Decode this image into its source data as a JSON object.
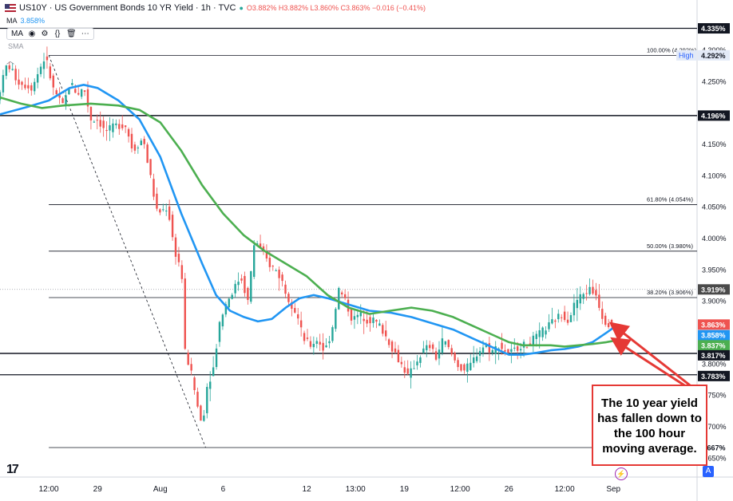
{
  "header": {
    "symbol": "US10Y · US Government Bonds 10 YR Yield · 1h · TVC",
    "ohlc": "O3.882% H3.882% L3.860% C3.863% −0.016 (−0.41%)"
  },
  "indicators": {
    "ma_label": "MA",
    "ma_value": "3.858%",
    "sma_label": "SMA",
    "toolbar_icons": [
      "eye-icon",
      "gear-icon",
      "code-icon",
      "trash-icon",
      "more-icon"
    ]
  },
  "callout": {
    "text_lines": [
      "The 10 year yield",
      "has fallen down to",
      "the 100 hour",
      "moving average."
    ]
  },
  "colors": {
    "ma100": "#2196f3",
    "ma200": "#4caf50",
    "up": "#26a69a",
    "down": "#ef5350",
    "arrow": "#e53935",
    "line": "#131722"
  },
  "chart_data": {
    "type": "candlestick",
    "ylim": [
      3.62,
      4.37
    ],
    "xlim": [
      0,
      100
    ],
    "x_ticks": [
      {
        "label": "12:00",
        "x": 7
      },
      {
        "label": "29",
        "x": 14
      },
      {
        "label": "Aug",
        "x": 23
      },
      {
        "label": "6",
        "x": 32
      },
      {
        "label": "12",
        "x": 44
      },
      {
        "label": "13:00",
        "x": 51
      },
      {
        "label": "19",
        "x": 58
      },
      {
        "label": "12:00",
        "x": 66
      },
      {
        "label": "26",
        "x": 73
      },
      {
        "label": "12:00",
        "x": 81
      },
      {
        "label": "Sep",
        "x": 88
      }
    ],
    "y_ticks": [
      {
        "label": "4.300%",
        "v": 4.3
      },
      {
        "label": "4.250%",
        "v": 4.25
      },
      {
        "label": "4.150%",
        "v": 4.15
      },
      {
        "label": "4.100%",
        "v": 4.1
      },
      {
        "label": "4.050%",
        "v": 4.05
      },
      {
        "label": "4.000%",
        "v": 4.0
      },
      {
        "label": "3.950%",
        "v": 3.95
      },
      {
        "label": "3.900%",
        "v": 3.9
      },
      {
        "label": "3.800%",
        "v": 3.8
      },
      {
        "label": "3.750%",
        "v": 3.75
      },
      {
        "label": "3.700%",
        "v": 3.7
      },
      {
        "label": "3.650%",
        "v": 3.65
      }
    ],
    "price_labels": [
      {
        "label": "4.335%",
        "v": 4.335,
        "bg": "#131722",
        "fg": "#ffffff"
      },
      {
        "label": "4.292%",
        "v": 4.292,
        "bg": "#e3eaf7",
        "fg": "#131722",
        "prefix": "High"
      },
      {
        "label": "4.196%",
        "v": 4.196,
        "bg": "#131722",
        "fg": "#ffffff"
      },
      {
        "label": "3.919%",
        "v": 3.919,
        "bg": "#4a4a4a",
        "fg": "#ffffff"
      },
      {
        "label": "3.863%",
        "v": 3.863,
        "bg": "#ef5350",
        "fg": "#ffffff"
      },
      {
        "label": "3.858%",
        "v": 3.846,
        "bg": "#2196f3",
        "fg": "#ffffff"
      },
      {
        "label": "3.837%",
        "v": 3.83,
        "bg": "#4caf50",
        "fg": "#ffffff"
      },
      {
        "label": "3.817%",
        "v": 3.814,
        "bg": "#131722",
        "fg": "#ffffff"
      },
      {
        "label": "3.783%",
        "v": 3.781,
        "bg": "#131722",
        "fg": "#ffffff"
      },
      {
        "label": "3.667%",
        "v": 3.667,
        "bg": "#ffffff",
        "fg": "#131722"
      }
    ],
    "horizontal_lines": [
      {
        "v": 4.335,
        "x_from": 0,
        "weight": 1.2
      },
      {
        "v": 4.196,
        "x_from": 0,
        "weight": 1.5
      },
      {
        "v": 3.817,
        "x_from": 0,
        "weight": 1.5
      },
      {
        "v": 3.783,
        "x_from": 0,
        "weight": 1.2
      }
    ],
    "fib_levels": [
      {
        "label": "100.00% (4.292%)",
        "v": 4.292
      },
      {
        "label": "61.80% (4.054%)",
        "v": 4.054
      },
      {
        "label": "50.00% (3.980%)",
        "v": 3.98
      },
      {
        "label": "38.20% (3.906%)",
        "v": 3.906
      },
      {
        "label": "",
        "v": 3.667
      }
    ],
    "fib_x_from": 7,
    "fib_diagonal": [
      {
        "x": 7,
        "v": 4.292
      },
      {
        "x": 29.5,
        "v": 3.667
      }
    ],
    "series": [
      {
        "name": "MA 100",
        "key": "ma100",
        "points": [
          [
            0,
            4.198
          ],
          [
            4,
            4.21
          ],
          [
            7,
            4.22
          ],
          [
            10,
            4.24
          ],
          [
            12,
            4.245
          ],
          [
            14,
            4.24
          ],
          [
            17,
            4.22
          ],
          [
            20,
            4.19
          ],
          [
            23,
            4.13
          ],
          [
            26,
            4.04
          ],
          [
            29,
            3.96
          ],
          [
            31,
            3.91
          ],
          [
            33,
            3.885
          ],
          [
            35,
            3.875
          ],
          [
            37,
            3.868
          ],
          [
            39,
            3.872
          ],
          [
            41,
            3.89
          ],
          [
            43,
            3.905
          ],
          [
            45,
            3.91
          ],
          [
            47,
            3.905
          ],
          [
            50,
            3.895
          ],
          [
            53,
            3.885
          ],
          [
            56,
            3.882
          ],
          [
            59,
            3.875
          ],
          [
            62,
            3.865
          ],
          [
            65,
            3.855
          ],
          [
            68,
            3.84
          ],
          [
            71,
            3.825
          ],
          [
            73,
            3.815
          ],
          [
            75,
            3.815
          ],
          [
            77,
            3.818
          ],
          [
            79,
            3.822
          ],
          [
            81,
            3.824
          ],
          [
            83,
            3.828
          ],
          [
            85,
            3.835
          ],
          [
            87,
            3.85
          ],
          [
            88,
            3.858
          ]
        ]
      },
      {
        "name": "MA 200",
        "key": "ma200",
        "points": [
          [
            0,
            4.225
          ],
          [
            3,
            4.215
          ],
          [
            6,
            4.208
          ],
          [
            9,
            4.212
          ],
          [
            13,
            4.215
          ],
          [
            17,
            4.212
          ],
          [
            20,
            4.205
          ],
          [
            23,
            4.185
          ],
          [
            26,
            4.14
          ],
          [
            29,
            4.085
          ],
          [
            32,
            4.04
          ],
          [
            35,
            4.005
          ],
          [
            38,
            3.98
          ],
          [
            41,
            3.96
          ],
          [
            44,
            3.94
          ],
          [
            47,
            3.91
          ],
          [
            50,
            3.89
          ],
          [
            53,
            3.88
          ],
          [
            56,
            3.885
          ],
          [
            59,
            3.89
          ],
          [
            62,
            3.885
          ],
          [
            65,
            3.875
          ],
          [
            68,
            3.86
          ],
          [
            71,
            3.845
          ],
          [
            73,
            3.835
          ],
          [
            75,
            3.83
          ],
          [
            77,
            3.83
          ],
          [
            79,
            3.83
          ],
          [
            81,
            3.828
          ],
          [
            83,
            3.83
          ],
          [
            85,
            3.832
          ],
          [
            87,
            3.835
          ],
          [
            88,
            3.837
          ]
        ]
      }
    ],
    "price_path": [
      [
        0,
        4.22
      ],
      [
        1.5,
        4.28
      ],
      [
        3,
        4.25
      ],
      [
        5,
        4.24
      ],
      [
        6.5,
        4.28
      ],
      [
        7,
        4.29
      ],
      [
        8,
        4.24
      ],
      [
        9.5,
        4.21
      ],
      [
        10.5,
        4.25
      ],
      [
        11.5,
        4.23
      ],
      [
        12.5,
        4.24
      ],
      [
        13.5,
        4.19
      ],
      [
        14.5,
        4.19
      ],
      [
        15.5,
        4.17
      ],
      [
        17,
        4.18
      ],
      [
        18.5,
        4.18
      ],
      [
        19.5,
        4.14
      ],
      [
        21,
        4.16
      ],
      [
        22,
        4.1
      ],
      [
        23,
        4.04
      ],
      [
        24.5,
        4.05
      ],
      [
        25.5,
        3.98
      ],
      [
        26.5,
        3.95
      ],
      [
        27,
        3.82
      ],
      [
        28,
        3.78
      ],
      [
        29,
        3.72
      ],
      [
        29.5,
        3.7
      ],
      [
        30,
        3.76
      ],
      [
        31,
        3.79
      ],
      [
        32,
        3.87
      ],
      [
        33,
        3.9
      ],
      [
        34,
        3.92
      ],
      [
        35,
        3.94
      ],
      [
        36,
        3.9
      ],
      [
        37,
        4.0
      ],
      [
        38,
        3.98
      ],
      [
        39,
        3.96
      ],
      [
        40,
        3.95
      ],
      [
        41,
        3.93
      ],
      [
        42,
        3.9
      ],
      [
        43,
        3.88
      ],
      [
        44,
        3.84
      ],
      [
        45,
        3.83
      ],
      [
        46,
        3.84
      ],
      [
        47,
        3.82
      ],
      [
        48,
        3.85
      ],
      [
        49,
        3.92
      ],
      [
        50,
        3.9
      ],
      [
        51,
        3.87
      ],
      [
        52,
        3.88
      ],
      [
        53,
        3.87
      ],
      [
        54,
        3.87
      ],
      [
        55,
        3.86
      ],
      [
        56,
        3.84
      ],
      [
        57,
        3.82
      ],
      [
        58,
        3.8
      ],
      [
        59,
        3.78
      ],
      [
        60,
        3.8
      ],
      [
        61,
        3.82
      ],
      [
        62,
        3.83
      ],
      [
        63,
        3.81
      ],
      [
        64,
        3.84
      ],
      [
        65,
        3.82
      ],
      [
        66,
        3.8
      ],
      [
        67,
        3.79
      ],
      [
        68,
        3.8
      ],
      [
        69,
        3.82
      ],
      [
        70,
        3.83
      ],
      [
        71,
        3.82
      ],
      [
        72,
        3.83
      ],
      [
        73,
        3.82
      ],
      [
        74,
        3.82
      ],
      [
        75,
        3.83
      ],
      [
        76,
        3.83
      ],
      [
        77,
        3.84
      ],
      [
        78,
        3.85
      ],
      [
        79,
        3.86
      ],
      [
        80,
        3.87
      ],
      [
        81,
        3.88
      ],
      [
        82,
        3.87
      ],
      [
        83,
        3.9
      ],
      [
        84,
        3.91
      ],
      [
        85,
        3.92
      ],
      [
        86,
        3.91
      ],
      [
        87,
        3.87
      ],
      [
        88,
        3.863
      ]
    ],
    "current_price_v": 3.919
  }
}
